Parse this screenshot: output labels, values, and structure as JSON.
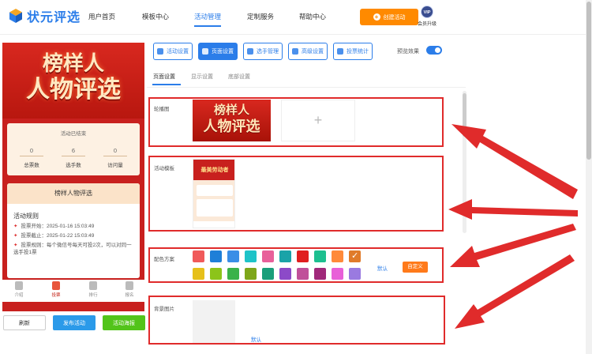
{
  "logo": {
    "text": "状元评选"
  },
  "nav": {
    "items": [
      {
        "label": "用户首页"
      },
      {
        "label": "模板中心"
      },
      {
        "label": "活动管理"
      },
      {
        "label": "定制服务"
      },
      {
        "label": "帮助中心"
      }
    ],
    "create_button": "创建活动",
    "vip_badge": "VIP",
    "vip_label": "会员升级"
  },
  "preview": {
    "banner_line1": "榜样人",
    "banner_line2": "人物评选",
    "status": "活动已结束",
    "stats": [
      {
        "value": "0",
        "label": "总票数"
      },
      {
        "value": "6",
        "label": "选手数"
      },
      {
        "value": "0",
        "label": "访问量"
      }
    ],
    "activity_name": "榜样人物评选",
    "rules_title": "活动规则",
    "rules": [
      "投票开始：2025-01-16 15:03:49",
      "投票截止：2025-01-22 15:03:49",
      "投票规则：每个微信号每天可投2次，可以对同一选手投1票"
    ],
    "tabbar": [
      {
        "label": "介绍"
      },
      {
        "label": "投票"
      },
      {
        "label": "排行"
      },
      {
        "label": "报名"
      }
    ]
  },
  "actions": {
    "refresh": "刷新",
    "publish": "发布活动",
    "poster": "活动海报"
  },
  "toolbar": {
    "buttons": [
      {
        "label": "活动设置",
        "icon": "gear-icon"
      },
      {
        "label": "页面设置",
        "icon": "page-icon"
      },
      {
        "label": "选手管理",
        "icon": "users-icon"
      },
      {
        "label": "高级设置",
        "icon": "advanced-icon"
      },
      {
        "label": "投票统计",
        "icon": "chart-icon"
      }
    ],
    "preview_label": "预览效果",
    "preview_on": true
  },
  "subtabs": [
    {
      "label": "页面设置"
    },
    {
      "label": "显示设置"
    },
    {
      "label": "底部设置"
    }
  ],
  "settings": {
    "carousel_label": "轮播图",
    "carousel_image_text_1": "榜样人",
    "carousel_image_text_2": "人物评选",
    "add_symbol": "+",
    "template_label": "活动模板",
    "template_thumb_title": "最美劳动者",
    "color_label": "配色方案",
    "color_default": "默认",
    "color_custom": "自定义",
    "colors_row1": [
      "#f05a5a",
      "#1e7fd8",
      "#3a8ee6",
      "#1ec3c8",
      "#e8609a",
      "#1aa3a8",
      "#e01e1e",
      "#1dbf8f",
      "#ff8a3a",
      "#e07b2a"
    ],
    "colors_row2": [
      "#e6c01a",
      "#8cc41a",
      "#3ab24a",
      "#7ea61a",
      "#1a9e7a",
      "#8c4ac8",
      "#c0509a",
      "#a0287a",
      "#e860d8",
      "#9a7ae0"
    ],
    "bg_label": "背景图片",
    "bg_default": "默认"
  }
}
